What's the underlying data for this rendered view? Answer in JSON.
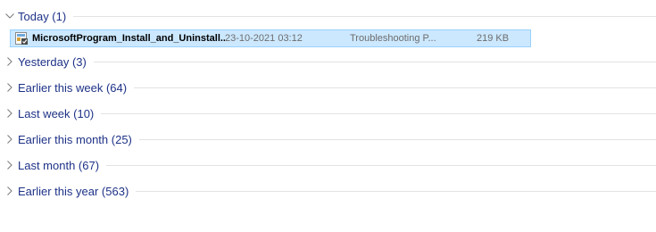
{
  "groups": [
    {
      "label": "Today (1)",
      "expanded": true
    },
    {
      "label": "Yesterday (3)",
      "expanded": false
    },
    {
      "label": "Earlier this week (64)",
      "expanded": false
    },
    {
      "label": "Last week (10)",
      "expanded": false
    },
    {
      "label": "Earlier this month (25)",
      "expanded": false
    },
    {
      "label": "Last month (67)",
      "expanded": false
    },
    {
      "label": "Earlier this year (563)",
      "expanded": false
    }
  ],
  "file": {
    "name": "MicrosoftProgram_Install_and_Uninstall....",
    "date": "23-10-2021 03:12",
    "type": "Troubleshooting P...",
    "size": "219 KB",
    "icon": "troubleshooter-file-icon",
    "selected": true
  },
  "colors": {
    "group_text": "#1e3287",
    "selection_bg": "#cce8ff",
    "selection_border": "#99d1ff",
    "divider": "#e3e3e3"
  }
}
